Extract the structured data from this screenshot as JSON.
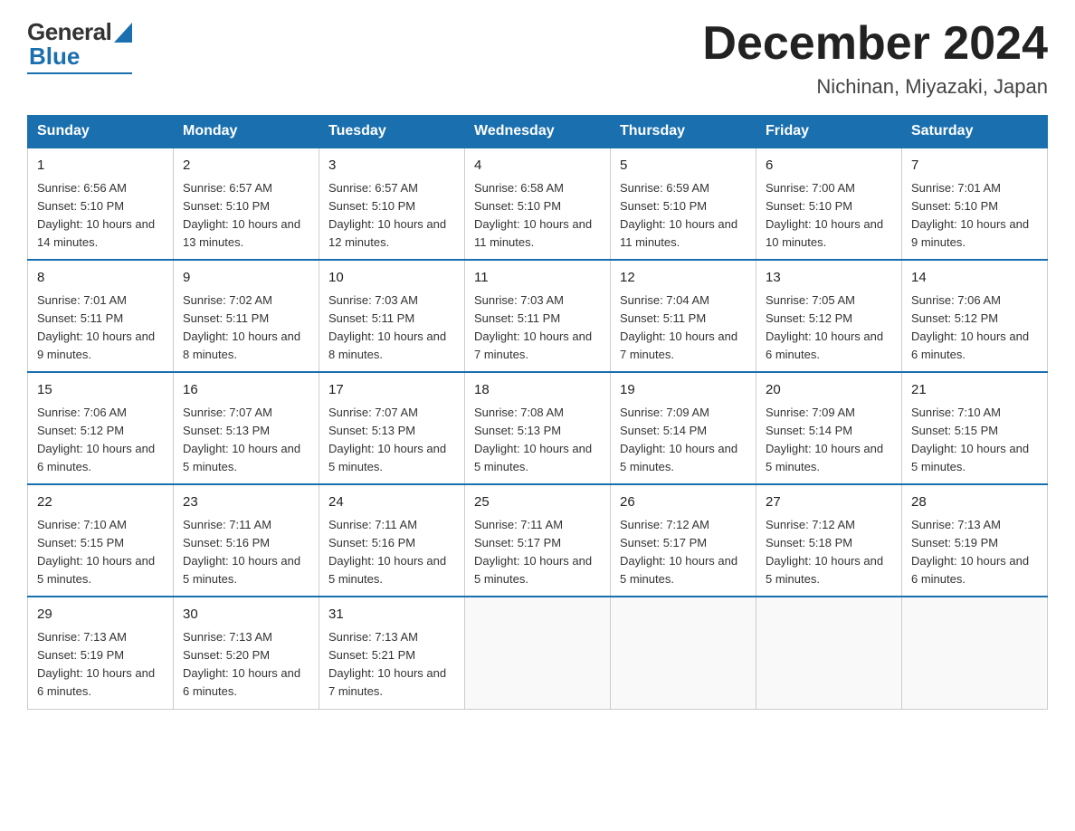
{
  "header": {
    "month_title": "December 2024",
    "location": "Nichinan, Miyazaki, Japan",
    "logo_general": "General",
    "logo_blue": "Blue"
  },
  "columns": [
    "Sunday",
    "Monday",
    "Tuesday",
    "Wednesday",
    "Thursday",
    "Friday",
    "Saturday"
  ],
  "weeks": [
    [
      {
        "day": "1",
        "sunrise": "Sunrise: 6:56 AM",
        "sunset": "Sunset: 5:10 PM",
        "daylight": "Daylight: 10 hours and 14 minutes."
      },
      {
        "day": "2",
        "sunrise": "Sunrise: 6:57 AM",
        "sunset": "Sunset: 5:10 PM",
        "daylight": "Daylight: 10 hours and 13 minutes."
      },
      {
        "day": "3",
        "sunrise": "Sunrise: 6:57 AM",
        "sunset": "Sunset: 5:10 PM",
        "daylight": "Daylight: 10 hours and 12 minutes."
      },
      {
        "day": "4",
        "sunrise": "Sunrise: 6:58 AM",
        "sunset": "Sunset: 5:10 PM",
        "daylight": "Daylight: 10 hours and 11 minutes."
      },
      {
        "day": "5",
        "sunrise": "Sunrise: 6:59 AM",
        "sunset": "Sunset: 5:10 PM",
        "daylight": "Daylight: 10 hours and 11 minutes."
      },
      {
        "day": "6",
        "sunrise": "Sunrise: 7:00 AM",
        "sunset": "Sunset: 5:10 PM",
        "daylight": "Daylight: 10 hours and 10 minutes."
      },
      {
        "day": "7",
        "sunrise": "Sunrise: 7:01 AM",
        "sunset": "Sunset: 5:10 PM",
        "daylight": "Daylight: 10 hours and 9 minutes."
      }
    ],
    [
      {
        "day": "8",
        "sunrise": "Sunrise: 7:01 AM",
        "sunset": "Sunset: 5:11 PM",
        "daylight": "Daylight: 10 hours and 9 minutes."
      },
      {
        "day": "9",
        "sunrise": "Sunrise: 7:02 AM",
        "sunset": "Sunset: 5:11 PM",
        "daylight": "Daylight: 10 hours and 8 minutes."
      },
      {
        "day": "10",
        "sunrise": "Sunrise: 7:03 AM",
        "sunset": "Sunset: 5:11 PM",
        "daylight": "Daylight: 10 hours and 8 minutes."
      },
      {
        "day": "11",
        "sunrise": "Sunrise: 7:03 AM",
        "sunset": "Sunset: 5:11 PM",
        "daylight": "Daylight: 10 hours and 7 minutes."
      },
      {
        "day": "12",
        "sunrise": "Sunrise: 7:04 AM",
        "sunset": "Sunset: 5:11 PM",
        "daylight": "Daylight: 10 hours and 7 minutes."
      },
      {
        "day": "13",
        "sunrise": "Sunrise: 7:05 AM",
        "sunset": "Sunset: 5:12 PM",
        "daylight": "Daylight: 10 hours and 6 minutes."
      },
      {
        "day": "14",
        "sunrise": "Sunrise: 7:06 AM",
        "sunset": "Sunset: 5:12 PM",
        "daylight": "Daylight: 10 hours and 6 minutes."
      }
    ],
    [
      {
        "day": "15",
        "sunrise": "Sunrise: 7:06 AM",
        "sunset": "Sunset: 5:12 PM",
        "daylight": "Daylight: 10 hours and 6 minutes."
      },
      {
        "day": "16",
        "sunrise": "Sunrise: 7:07 AM",
        "sunset": "Sunset: 5:13 PM",
        "daylight": "Daylight: 10 hours and 5 minutes."
      },
      {
        "day": "17",
        "sunrise": "Sunrise: 7:07 AM",
        "sunset": "Sunset: 5:13 PM",
        "daylight": "Daylight: 10 hours and 5 minutes."
      },
      {
        "day": "18",
        "sunrise": "Sunrise: 7:08 AM",
        "sunset": "Sunset: 5:13 PM",
        "daylight": "Daylight: 10 hours and 5 minutes."
      },
      {
        "day": "19",
        "sunrise": "Sunrise: 7:09 AM",
        "sunset": "Sunset: 5:14 PM",
        "daylight": "Daylight: 10 hours and 5 minutes."
      },
      {
        "day": "20",
        "sunrise": "Sunrise: 7:09 AM",
        "sunset": "Sunset: 5:14 PM",
        "daylight": "Daylight: 10 hours and 5 minutes."
      },
      {
        "day": "21",
        "sunrise": "Sunrise: 7:10 AM",
        "sunset": "Sunset: 5:15 PM",
        "daylight": "Daylight: 10 hours and 5 minutes."
      }
    ],
    [
      {
        "day": "22",
        "sunrise": "Sunrise: 7:10 AM",
        "sunset": "Sunset: 5:15 PM",
        "daylight": "Daylight: 10 hours and 5 minutes."
      },
      {
        "day": "23",
        "sunrise": "Sunrise: 7:11 AM",
        "sunset": "Sunset: 5:16 PM",
        "daylight": "Daylight: 10 hours and 5 minutes."
      },
      {
        "day": "24",
        "sunrise": "Sunrise: 7:11 AM",
        "sunset": "Sunset: 5:16 PM",
        "daylight": "Daylight: 10 hours and 5 minutes."
      },
      {
        "day": "25",
        "sunrise": "Sunrise: 7:11 AM",
        "sunset": "Sunset: 5:17 PM",
        "daylight": "Daylight: 10 hours and 5 minutes."
      },
      {
        "day": "26",
        "sunrise": "Sunrise: 7:12 AM",
        "sunset": "Sunset: 5:17 PM",
        "daylight": "Daylight: 10 hours and 5 minutes."
      },
      {
        "day": "27",
        "sunrise": "Sunrise: 7:12 AM",
        "sunset": "Sunset: 5:18 PM",
        "daylight": "Daylight: 10 hours and 5 minutes."
      },
      {
        "day": "28",
        "sunrise": "Sunrise: 7:13 AM",
        "sunset": "Sunset: 5:19 PM",
        "daylight": "Daylight: 10 hours and 6 minutes."
      }
    ],
    [
      {
        "day": "29",
        "sunrise": "Sunrise: 7:13 AM",
        "sunset": "Sunset: 5:19 PM",
        "daylight": "Daylight: 10 hours and 6 minutes."
      },
      {
        "day": "30",
        "sunrise": "Sunrise: 7:13 AM",
        "sunset": "Sunset: 5:20 PM",
        "daylight": "Daylight: 10 hours and 6 minutes."
      },
      {
        "day": "31",
        "sunrise": "Sunrise: 7:13 AM",
        "sunset": "Sunset: 5:21 PM",
        "daylight": "Daylight: 10 hours and 7 minutes."
      },
      null,
      null,
      null,
      null
    ]
  ]
}
